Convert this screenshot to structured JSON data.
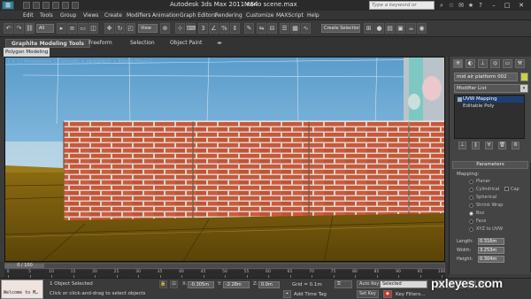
{
  "window": {
    "app_title": "Autodesk 3ds Max  2011 x64",
    "file_name": "Mario scene.max",
    "search_placeholder": "Type a keyword or phrase"
  },
  "menu": [
    "Edit",
    "Tools",
    "Group",
    "Views",
    "Create",
    "Modifiers",
    "Animation",
    "Graph Editors",
    "Rendering",
    "Customize",
    "MAXScript",
    "Help"
  ],
  "toolbar": {
    "selection_filter": "All",
    "reference_coord": "View",
    "named_selection": "Create Selection Se"
  },
  "ribbon": {
    "tabs": [
      "Graphite Modeling Tools",
      "Freeform",
      "Selection",
      "Object Paint"
    ],
    "sub_tab": "Polygon Modeling"
  },
  "viewport": {
    "label": "[ + ] [ Perspective ] [ Smooth + Highlights + Edged Faces ]"
  },
  "command_panel": {
    "object_name": "mid air platform 002",
    "object_color": "#c6d34a",
    "modifier_list_label": "Modifier List",
    "stack": [
      "UVW Mapping",
      "Editable Poly"
    ],
    "parameters_title": "Parameters",
    "mapping_label": "Mapping:",
    "mapping_options": [
      {
        "label": "Planar",
        "selected": false
      },
      {
        "label": "Cylindrical",
        "selected": false
      },
      {
        "label": "Spherical",
        "selected": false
      },
      {
        "label": "Shrink Wrap",
        "selected": false
      },
      {
        "label": "Box",
        "selected": true
      },
      {
        "label": "Face",
        "selected": false
      },
      {
        "label": "XYZ to UVW",
        "selected": false
      }
    ],
    "cap_label": "Cap",
    "length_label": "Length:",
    "length_value": "0.316m",
    "width_label": "Width:",
    "width_value": "3.253m",
    "height_label": "Height:",
    "height_value": "0.304m"
  },
  "timeline": {
    "frame_readout": "0 / 100",
    "ticks": [
      "0",
      "5",
      "10",
      "15",
      "20",
      "25",
      "30",
      "35",
      "40",
      "45",
      "50",
      "55",
      "60",
      "65",
      "70",
      "75",
      "80",
      "85",
      "90",
      "95",
      "100"
    ]
  },
  "statusbar": {
    "maxscript_text": "Welcome to M…",
    "objects_selected": "1 Object Selected",
    "prompt": "Click or click-and-drag to select objects",
    "x_label": "X:",
    "x_value": "-0.305m",
    "y_label": "Y:",
    "y_value": "-2.28m",
    "z_label": "Z:",
    "z_value": "0.0m",
    "grid": "Grid = 0.1m",
    "add_time_tag": "Add Time Tag",
    "auto_key": "Auto Key",
    "selected": "Selected",
    "set_key": "Set Key",
    "key_filters": "Key Filters..."
  },
  "watermark": "pxleyes.com"
}
